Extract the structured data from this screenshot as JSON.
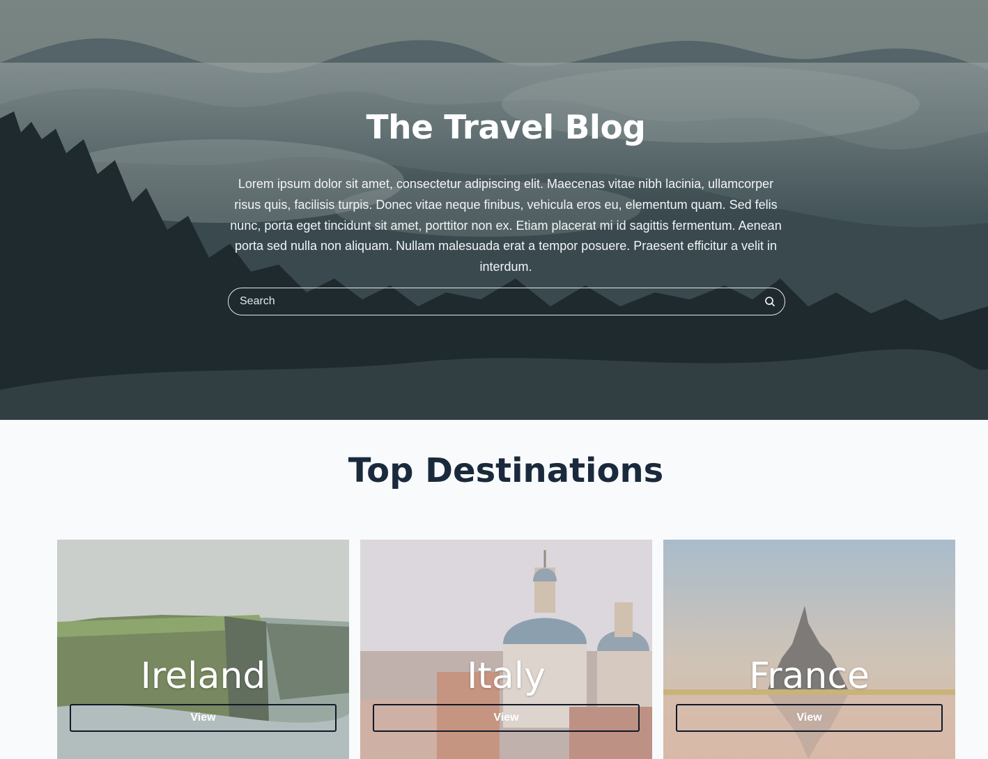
{
  "hero": {
    "title": "The Travel Blog",
    "description": "Lorem ipsum dolor sit amet, consectetur adipiscing elit. Maecenas vitae nibh lacinia, ullamcorper risus quis, facilisis turpis. Donec vitae neque finibus, vehicula eros eu, elementum quam. Sed felis nunc, porta eget tincidunt sit amet, porttitor non ex. Etiam placerat mi id sagittis fermentum. Aenean porta sed nulla non aliquam. Nullam malesuada erat a tempor posuere. Praesent efficitur a velit in interdum.",
    "search": {
      "placeholder": "Search",
      "value": "",
      "icon": "search-icon"
    }
  },
  "destinations": {
    "title": "Top Destinations",
    "cards": [
      {
        "name": "Ireland",
        "button_label": "View"
      },
      {
        "name": "Italy",
        "button_label": "View"
      },
      {
        "name": "France",
        "button_label": "View"
      }
    ]
  },
  "colors": {
    "page_background": "#f8fafc",
    "heading": "#1a2a3c",
    "hero_text": "#ffffff",
    "button_border": "#111827"
  }
}
